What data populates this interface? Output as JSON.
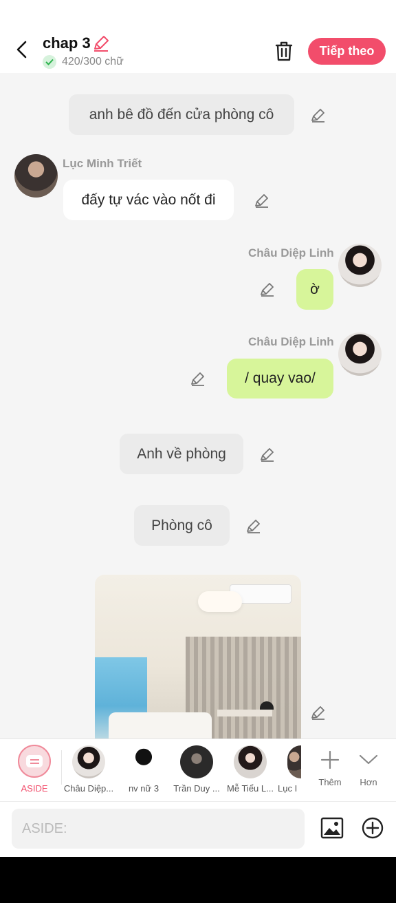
{
  "header": {
    "title": "chap 3",
    "word_count": "420/300 chữ",
    "next_label": "Tiếp theo"
  },
  "messages": [
    {
      "type": "narration",
      "text": "anh bê đồ đến cửa phòng cô"
    },
    {
      "type": "left",
      "name": "Lục Minh Triết",
      "text": "đấy tự vác vào nốt đi"
    },
    {
      "type": "right",
      "name": "Châu Diệp Linh",
      "text": "ờ"
    },
    {
      "type": "right",
      "name": "Châu Diệp Linh",
      "text": "/ quay vao/"
    },
    {
      "type": "narration",
      "text": "Anh về phòng"
    },
    {
      "type": "narration",
      "text": "Phòng cô"
    },
    {
      "type": "image"
    }
  ],
  "charbar": {
    "aside_label": "ASIDE",
    "characters": [
      {
        "label": "Châu Diệp..."
      },
      {
        "label": "nv nữ 3"
      },
      {
        "label": "Trần Duy ..."
      },
      {
        "label": "Mễ Tiểu L..."
      },
      {
        "label": "Lục I"
      }
    ],
    "more_label": "Thêm",
    "expand_label": "Hơn"
  },
  "input": {
    "placeholder": "ASIDE:",
    "value": ""
  },
  "colors": {
    "accent": "#f24d6b",
    "bubble_green": "#d7f59a",
    "narration_bg": "#ebebeb",
    "background": "#f5f5f5"
  },
  "icons": [
    "back-arrow-icon",
    "edit-pencil-icon",
    "check-icon",
    "trash-icon",
    "aside-icon",
    "plus-icon",
    "chevron-down-icon",
    "image-icon",
    "add-circle-icon"
  ]
}
